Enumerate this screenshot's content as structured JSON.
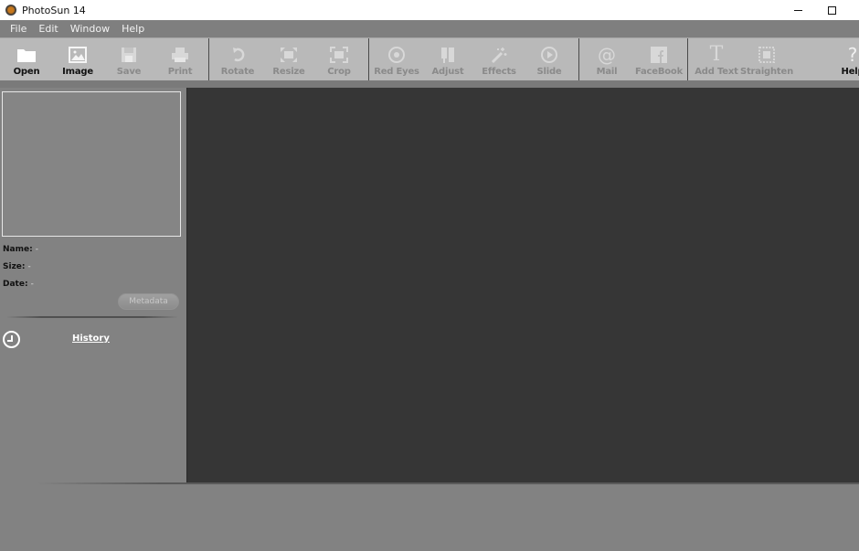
{
  "window": {
    "title": "PhotoSun 14",
    "app_icon": "photosun-logo-icon",
    "controls": {
      "minimize": "minimize-icon",
      "maximize": "maximize-icon"
    }
  },
  "menubar": {
    "items": [
      {
        "label": "File"
      },
      {
        "label": "Edit"
      },
      {
        "label": "Window"
      },
      {
        "label": "Help"
      }
    ]
  },
  "toolbar": {
    "tools": [
      {
        "label": "Open",
        "icon": "folder-icon",
        "enabled": true
      },
      {
        "label": "Image",
        "icon": "image-icon",
        "enabled": true
      },
      {
        "label": "Save",
        "icon": "save-icon",
        "enabled": false
      },
      {
        "label": "Print",
        "icon": "print-icon",
        "enabled": false
      },
      {
        "label": "Rotate",
        "icon": "rotate-icon",
        "enabled": false
      },
      {
        "label": "Resize",
        "icon": "resize-icon",
        "enabled": false
      },
      {
        "label": "Crop",
        "icon": "crop-icon",
        "enabled": false
      },
      {
        "label": "Red Eyes",
        "icon": "red-eyes-icon",
        "enabled": false
      },
      {
        "label": "Adjust",
        "icon": "adjust-icon",
        "enabled": false
      },
      {
        "label": "Effects",
        "icon": "magic-wand-icon",
        "enabled": false
      },
      {
        "label": "Slide",
        "icon": "play-icon",
        "enabled": false
      },
      {
        "label": "Mail",
        "icon": "at-sign-icon",
        "enabled": false
      },
      {
        "label": "FaceBook",
        "icon": "facebook-icon",
        "enabled": false
      },
      {
        "label": "Add Text",
        "icon": "text-icon",
        "enabled": false
      },
      {
        "label": "Straighten",
        "icon": "straighten-icon",
        "enabled": false
      },
      {
        "label": "Help",
        "icon": "help-icon",
        "enabled": true
      }
    ]
  },
  "sidebar": {
    "info": {
      "name_label": "Name:",
      "name_value": "-",
      "size_label": "Size:",
      "size_value": "-",
      "date_label": "Date:",
      "date_value": "-"
    },
    "metadata_button": "Metadata",
    "history_label": "History"
  }
}
